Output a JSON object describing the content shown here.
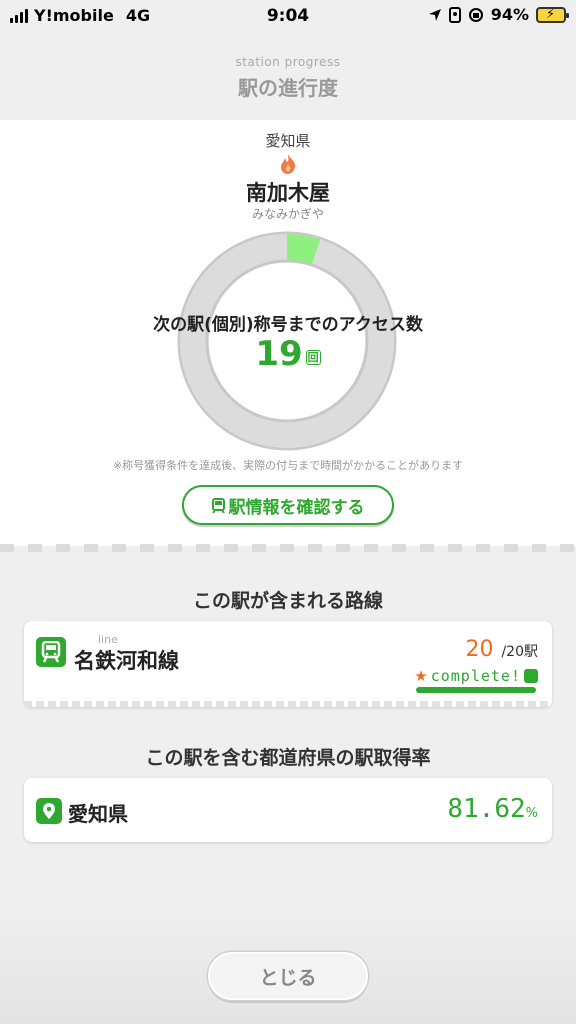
{
  "status_bar": {
    "carrier": "Y!mobile",
    "network": "4G",
    "time": "9:04",
    "battery": "94%"
  },
  "header": {
    "subtitle": "station progress",
    "title": "駅の進行度"
  },
  "station": {
    "prefecture": "愛知県",
    "name": "南加木屋",
    "kana": "みなみかぎや"
  },
  "progress": {
    "label": "次の駅(個別)称号までのアクセス数",
    "count": "19",
    "unit": "回",
    "ring_fill_fraction": 0.05,
    "note": "※称号獲得条件を達成後、実際の付与まで時間がかかることがあります"
  },
  "info_button": {
    "label": "駅情報を確認する"
  },
  "lines_section": {
    "title": "この駅が含まれる路線",
    "items": [
      {
        "small_label": "line",
        "name": "名鉄河和線",
        "acquired": "20",
        "total": "/20駅",
        "complete_label": "complete!"
      }
    ]
  },
  "prefecture_section": {
    "title": "この駅を含む都道府県の駅取得率",
    "name": "愛知県",
    "rate": "81.62",
    "unit": "%"
  },
  "close_button": {
    "label": "とじる"
  },
  "colors": {
    "accent_green": "#2fa82f",
    "ring_fill": "#8ef07e",
    "ring_track": "#dcdcdc",
    "orange": "#f26b1d"
  }
}
